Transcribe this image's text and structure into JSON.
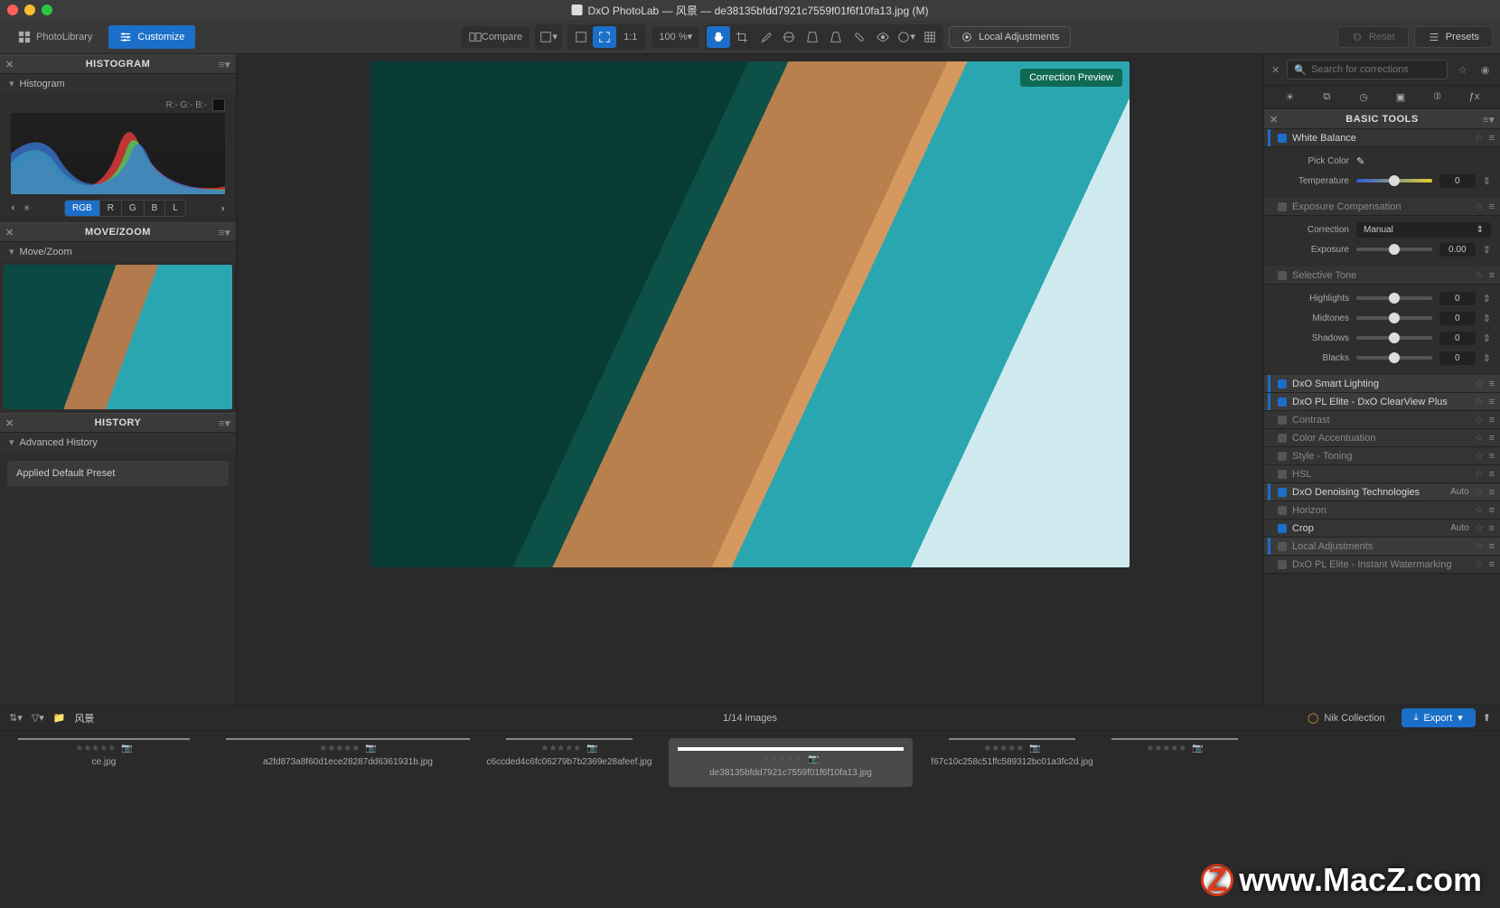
{
  "titlebar": {
    "app": "DxO PhotoLab",
    "folder": "风景",
    "filename": "de38135bfdd7921c7559f01f6f10fa13.jpg",
    "modified_suffix": "(M)"
  },
  "toolbar": {
    "photo_library": "PhotoLibrary",
    "customize": "Customize",
    "compare": "Compare",
    "ratio_label": "1:1",
    "zoom_percent": "100 %",
    "local_adjustments": "Local Adjustments",
    "reset": "Reset",
    "presets": "Presets"
  },
  "left": {
    "histogram_title": "HISTOGRAM",
    "histogram_sub": "Histogram",
    "rgb_label": "R:- G:- B:-",
    "channels": [
      "RGB",
      "R",
      "G",
      "B",
      "L"
    ],
    "movezoom_title": "MOVE/ZOOM",
    "movezoom_sub": "Move/Zoom",
    "history_title": "HISTORY",
    "history_sub": "Advanced History",
    "history_item": "Applied Default Preset"
  },
  "center": {
    "badge": "Correction Preview"
  },
  "right": {
    "search_placeholder": "Search for corrections",
    "basic_tools_title": "BASIC TOOLS",
    "white_balance": {
      "title": "White Balance",
      "pick": "Pick Color",
      "temperature": "Temperature",
      "temp_val": "0"
    },
    "exposure": {
      "title": "Exposure Compensation",
      "correction": "Correction",
      "mode": "Manual",
      "exposure": "Exposure",
      "val": "0.00"
    },
    "selective": {
      "title": "Selective Tone",
      "highlights": "Highlights",
      "midtones": "Midtones",
      "shadows": "Shadows",
      "blacks": "Blacks",
      "v": "0"
    },
    "tools": [
      {
        "title": "DxO Smart Lighting",
        "on": true,
        "bar": true,
        "badge": "",
        "hi": true
      },
      {
        "title": "DxO PL Elite - DxO ClearView Plus",
        "on": true,
        "bar": true,
        "badge": "",
        "hi": true
      },
      {
        "title": "Contrast",
        "on": false,
        "bar": false,
        "badge": ""
      },
      {
        "title": "Color Accentuation",
        "on": false,
        "bar": false,
        "badge": ""
      },
      {
        "title": "Style - Toning",
        "on": false,
        "bar": false,
        "badge": ""
      },
      {
        "title": "HSL",
        "on": false,
        "bar": false,
        "badge": ""
      },
      {
        "title": "DxO Denoising Technologies",
        "on": true,
        "bar": true,
        "badge": "Auto",
        "hi": true
      },
      {
        "title": "Horizon",
        "on": false,
        "bar": false,
        "badge": ""
      },
      {
        "title": "Crop",
        "on": true,
        "bar": false,
        "badge": "Auto"
      },
      {
        "title": "Local Adjustments",
        "on": false,
        "bar": true,
        "badge": "",
        "hi": true
      },
      {
        "title": "DxO PL Elite - Instant Watermarking",
        "on": false,
        "bar": false,
        "badge": ""
      }
    ]
  },
  "filmstrip": {
    "folder_label": "风景",
    "count": "1/14 images",
    "nik": "Nik Collection",
    "export": "Export",
    "thumbs": [
      {
        "label": "ce.jpg",
        "cls": "first",
        "img": "ls1"
      },
      {
        "label": "a2fd873a8f60d1ece28287dd6361931b.jpg",
        "cls": "",
        "img": "ls1"
      },
      {
        "label": "c6ccded4c6fc06279b7b2369e28afeef.jpg",
        "cls": "portrait",
        "img": "p1"
      },
      {
        "label": "de38135bfdd7921c7559f01f6f10fa13.jpg",
        "cls": "selected",
        "img": "ls2"
      },
      {
        "label": "f67c10c258c51ffc589312bc01a3fc2d.jpg",
        "cls": "portrait",
        "img": "p2"
      },
      {
        "label": "",
        "cls": "portrait",
        "img": "p3"
      }
    ]
  },
  "watermark": "www.MacZ.com"
}
